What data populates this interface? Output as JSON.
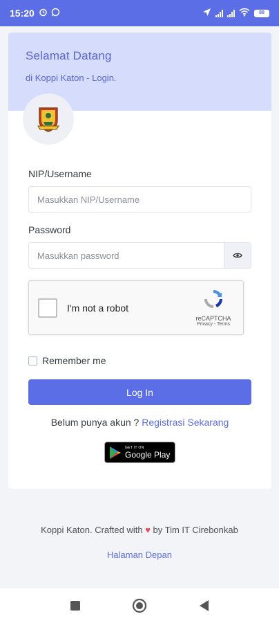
{
  "status_bar": {
    "time": "15:20",
    "battery": "88",
    "icons": [
      "alarm-icon",
      "whatsapp-icon",
      "location-icon",
      "signal-icon",
      "signal-icon",
      "wifi-icon",
      "battery-icon"
    ]
  },
  "header": {
    "title": "Selamat Datang",
    "subtitle": "di Koppi Katon - Login."
  },
  "form": {
    "username_label": "NIP/Username",
    "username_placeholder": "Masukkan NIP/Username",
    "password_label": "Password",
    "password_placeholder": "Masukkan password",
    "recaptcha_text": "I'm not a robot",
    "recaptcha_brand": "reCAPTCHA",
    "recaptcha_terms": "Privacy - Terms",
    "remember_label": "Remember me",
    "login_label": "Log In",
    "register_prompt": "Belum punya akun ?",
    "register_link": "Registrasi Sekarang"
  },
  "store_badge": {
    "line1": "GET IT ON",
    "line2": "Google Play"
  },
  "footer": {
    "text_before": "Koppi Katon. Crafted with",
    "text_after": "by Tim IT Cirebonkab",
    "home_link": "Halaman Depan"
  },
  "colors": {
    "primary": "#5b6ee6",
    "header_bg": "#d6dcfb",
    "heart": "#e64a5b"
  }
}
